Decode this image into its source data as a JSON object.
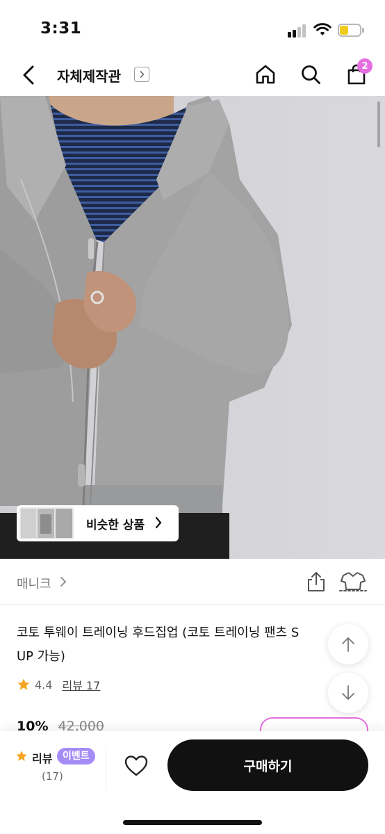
{
  "status_bar": {
    "time": "3:31"
  },
  "nav": {
    "title": "자체제작관",
    "cart_count": "2"
  },
  "hero": {
    "similar_button_label": "비슷한 상품"
  },
  "brand": {
    "name": "매니크"
  },
  "product": {
    "title_line1": "코토 투웨이 트레이닝 후드집업 (코토 트레이닝 팬츠 S",
    "title_line2": "UP 가능)",
    "rating": "4.4",
    "review_link": "리뷰 17",
    "discount": "10%",
    "original_price": "42,000"
  },
  "bottom_bar": {
    "review_label": "리뷰",
    "event_badge": "이벤트",
    "review_count": "(17)",
    "buy_label": "구매하기"
  },
  "colors": {
    "accent_pink": "#e56fe0",
    "event_purple": "#a58cf5",
    "star_orange": "#f5a623",
    "buy_button": "#111111"
  }
}
